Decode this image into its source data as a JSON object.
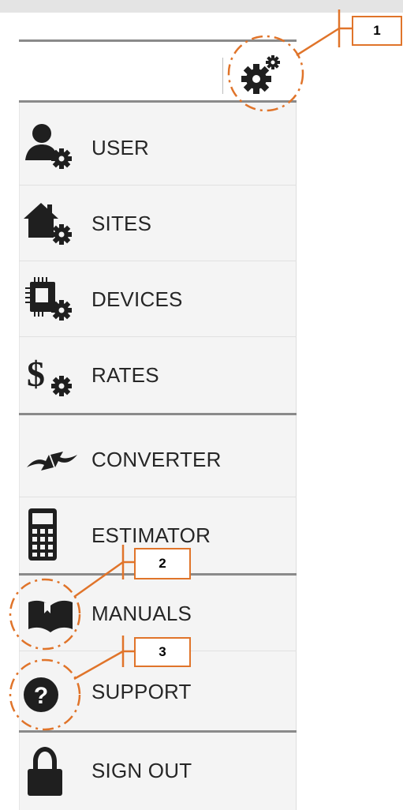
{
  "menu": {
    "settings_icon": "gears-icon",
    "items": [
      {
        "label": "USER",
        "icon": "user-gear-icon"
      },
      {
        "label": "SITES",
        "icon": "house-gear-icon"
      },
      {
        "label": "DEVICES",
        "icon": "chip-gear-icon"
      },
      {
        "label": "RATES",
        "icon": "dollar-gear-icon"
      },
      {
        "label": "CONVERTER",
        "icon": "convert-arrows-icon"
      },
      {
        "label": "ESTIMATOR",
        "icon": "calculator-icon"
      },
      {
        "label": "MANUALS",
        "icon": "book-icon"
      },
      {
        "label": "SUPPORT",
        "icon": "question-icon"
      },
      {
        "label": "SIGN OUT",
        "icon": "lock-icon"
      }
    ]
  },
  "callouts": {
    "c1": "1",
    "c2": "2",
    "c3": "3"
  },
  "colors": {
    "accent": "#e0742a",
    "icon": "#1f1f1f",
    "text": "#262626",
    "separator": "#8a8a8a"
  }
}
